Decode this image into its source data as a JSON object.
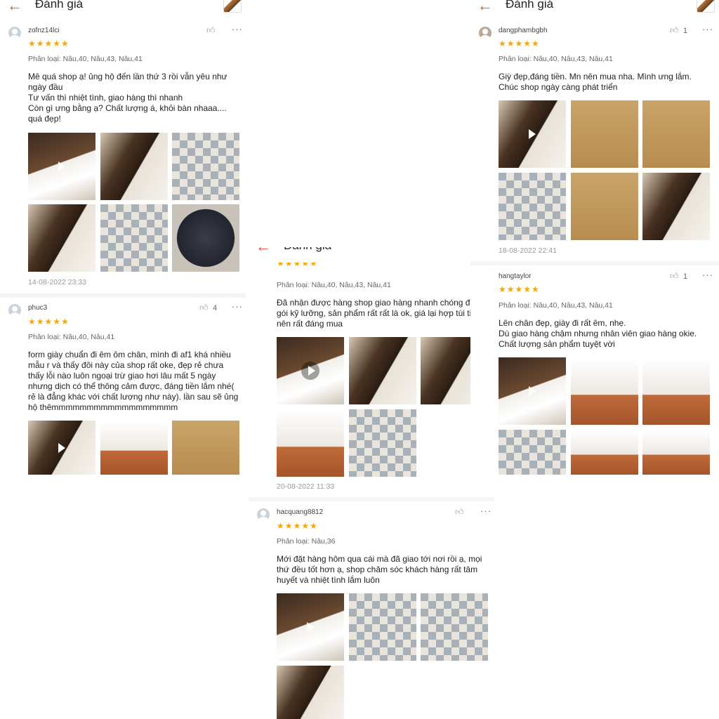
{
  "colors": {
    "accent": "#ee4d2d",
    "star": "#f6a700"
  },
  "panels": [
    {
      "header": {
        "back_icon": "arrow-left-icon",
        "title": "Đánh giá"
      },
      "reviews": [
        {
          "user": "zofnz14lci",
          "likes": "",
          "stars": "★★★★★",
          "variant": "Phân loại: Nâu,40, Nâu,43, Nâu,41",
          "text": "Mê quá shop ạ! ủng hộ đến lần thứ 3 rồi vẫn yêu như ngày đầu\nTư vấn thì nhiệt tình, giao hàng thì nhanh\nCòn gì ưng bằng ạ? Chất lượng á, khỏi bàn nhaaa.... quá đẹp!",
          "date": "14-08-2022 23:33"
        },
        {
          "user": "phuc3",
          "likes": "4",
          "stars": "★★★★★",
          "variant": "Phân loại: Nâu,40, Nâu,41",
          "text": "form giày chuẩn đi êm ôm chân, mình đi af1 khá nhiều mẫu r và thấy đôi này của shop rất oke, đẹp rẻ chưa thấy lỗi nào luôn ngoại trừ giao hơi lâu mất 5 ngày nhưng dịch có thể thông cảm được, đáng tiền lắm nhé( rẻ là đẳng khác với chất lượng như này). lần sau sẽ ủng hộ thêmmmmmmmmmmmmmmmmmm",
          "date": ""
        }
      ]
    },
    {
      "header": {
        "back_icon": "arrow-left-icon",
        "title": "Đánh giá"
      },
      "reviews": [
        {
          "user": "",
          "likes": "",
          "stars": "★★★★★",
          "variant": "Phân loại: Nâu,40, Nâu,43, Nâu,41",
          "text": "Đã nhận được hàng shop giao hàng nhanh chóng đóng gói kỹ lưỡng, sản phẩm rất rất là ok, giá lại hợp túi tiền nên rất đáng mua",
          "date": "20-08-2022 11:33"
        },
        {
          "user": "hacquang8812",
          "likes": "",
          "stars": "★★★★★",
          "variant": "Phân loại: Nâu,36",
          "text": "Mới đặt hàng hôm qua cái mà đã giao tới nơi rồi ạ, mọi thứ đều tốt hơn ạ, shop chăm sóc khách hàng rất tâm huyết và nhiệt tình lắm luôn",
          "date": ""
        }
      ]
    },
    {
      "header": {
        "back_icon": "arrow-left-icon",
        "title": "Đánh giá"
      },
      "reviews": [
        {
          "user": "dangphambgbh",
          "likes": "1",
          "stars": "★★★★★",
          "variant": "Phân loại: Nâu,40, Nâu,43, Nâu,41",
          "text": "Giỳ đẹp,đáng tiền. Mn nên mua nha. Mình ưng lắm.\nChúc shop ngày càng phát triển",
          "date": "18-08-2022 22:41"
        },
        {
          "user": "hangtaylor",
          "likes": "1",
          "stars": "★★★★★",
          "variant": "Phân loại: Nâu,40, Nâu,43, Nâu,41",
          "text": "Lên chân đẹp, giày đi rất êm, nhẹ.\nDù giao hàng chậm nhưng nhân viên giao hàng okie.\nChất lượng sản phẩm tuyệt vời",
          "date": ""
        }
      ]
    }
  ],
  "icons": {
    "like": "thumbs-up-icon",
    "more": "more-options-icon",
    "play": "play-icon",
    "avatar": "avatar-icon"
  }
}
